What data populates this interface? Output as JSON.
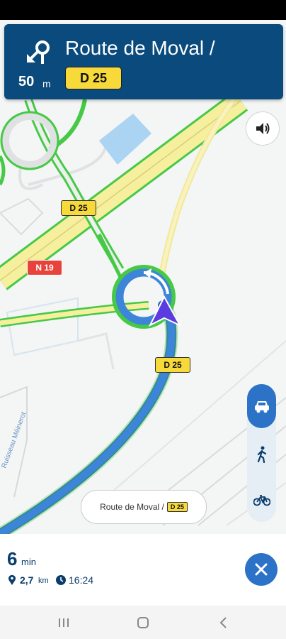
{
  "banner": {
    "distance_value": "50",
    "distance_unit": "m",
    "street": "Route de Moval /",
    "road_ref": "D 25",
    "turn_icon": "roundabout-exit-icon"
  },
  "map": {
    "labels": {
      "d25_top": "D 25",
      "n19": "N 19",
      "d25_bottom": "D 25",
      "stream": "Ruisseau Méinerot"
    },
    "destination": {
      "street": "Route de Moval /",
      "road_ref": "D 25"
    },
    "colors": {
      "route": "#3d85d8",
      "traffic_green": "#46c946",
      "major_road": "#f6ef9e",
      "water": "#aad4f2",
      "position_marker": "#5b3ce0"
    }
  },
  "modes": [
    "car-icon",
    "walk-icon",
    "bike-icon"
  ],
  "trip": {
    "minutes": "6",
    "minutes_unit": "min",
    "distance": "2,7",
    "distance_unit": "km",
    "arrival": "16:24"
  },
  "system_nav": [
    "recent-apps-icon",
    "home-icon",
    "back-icon"
  ]
}
